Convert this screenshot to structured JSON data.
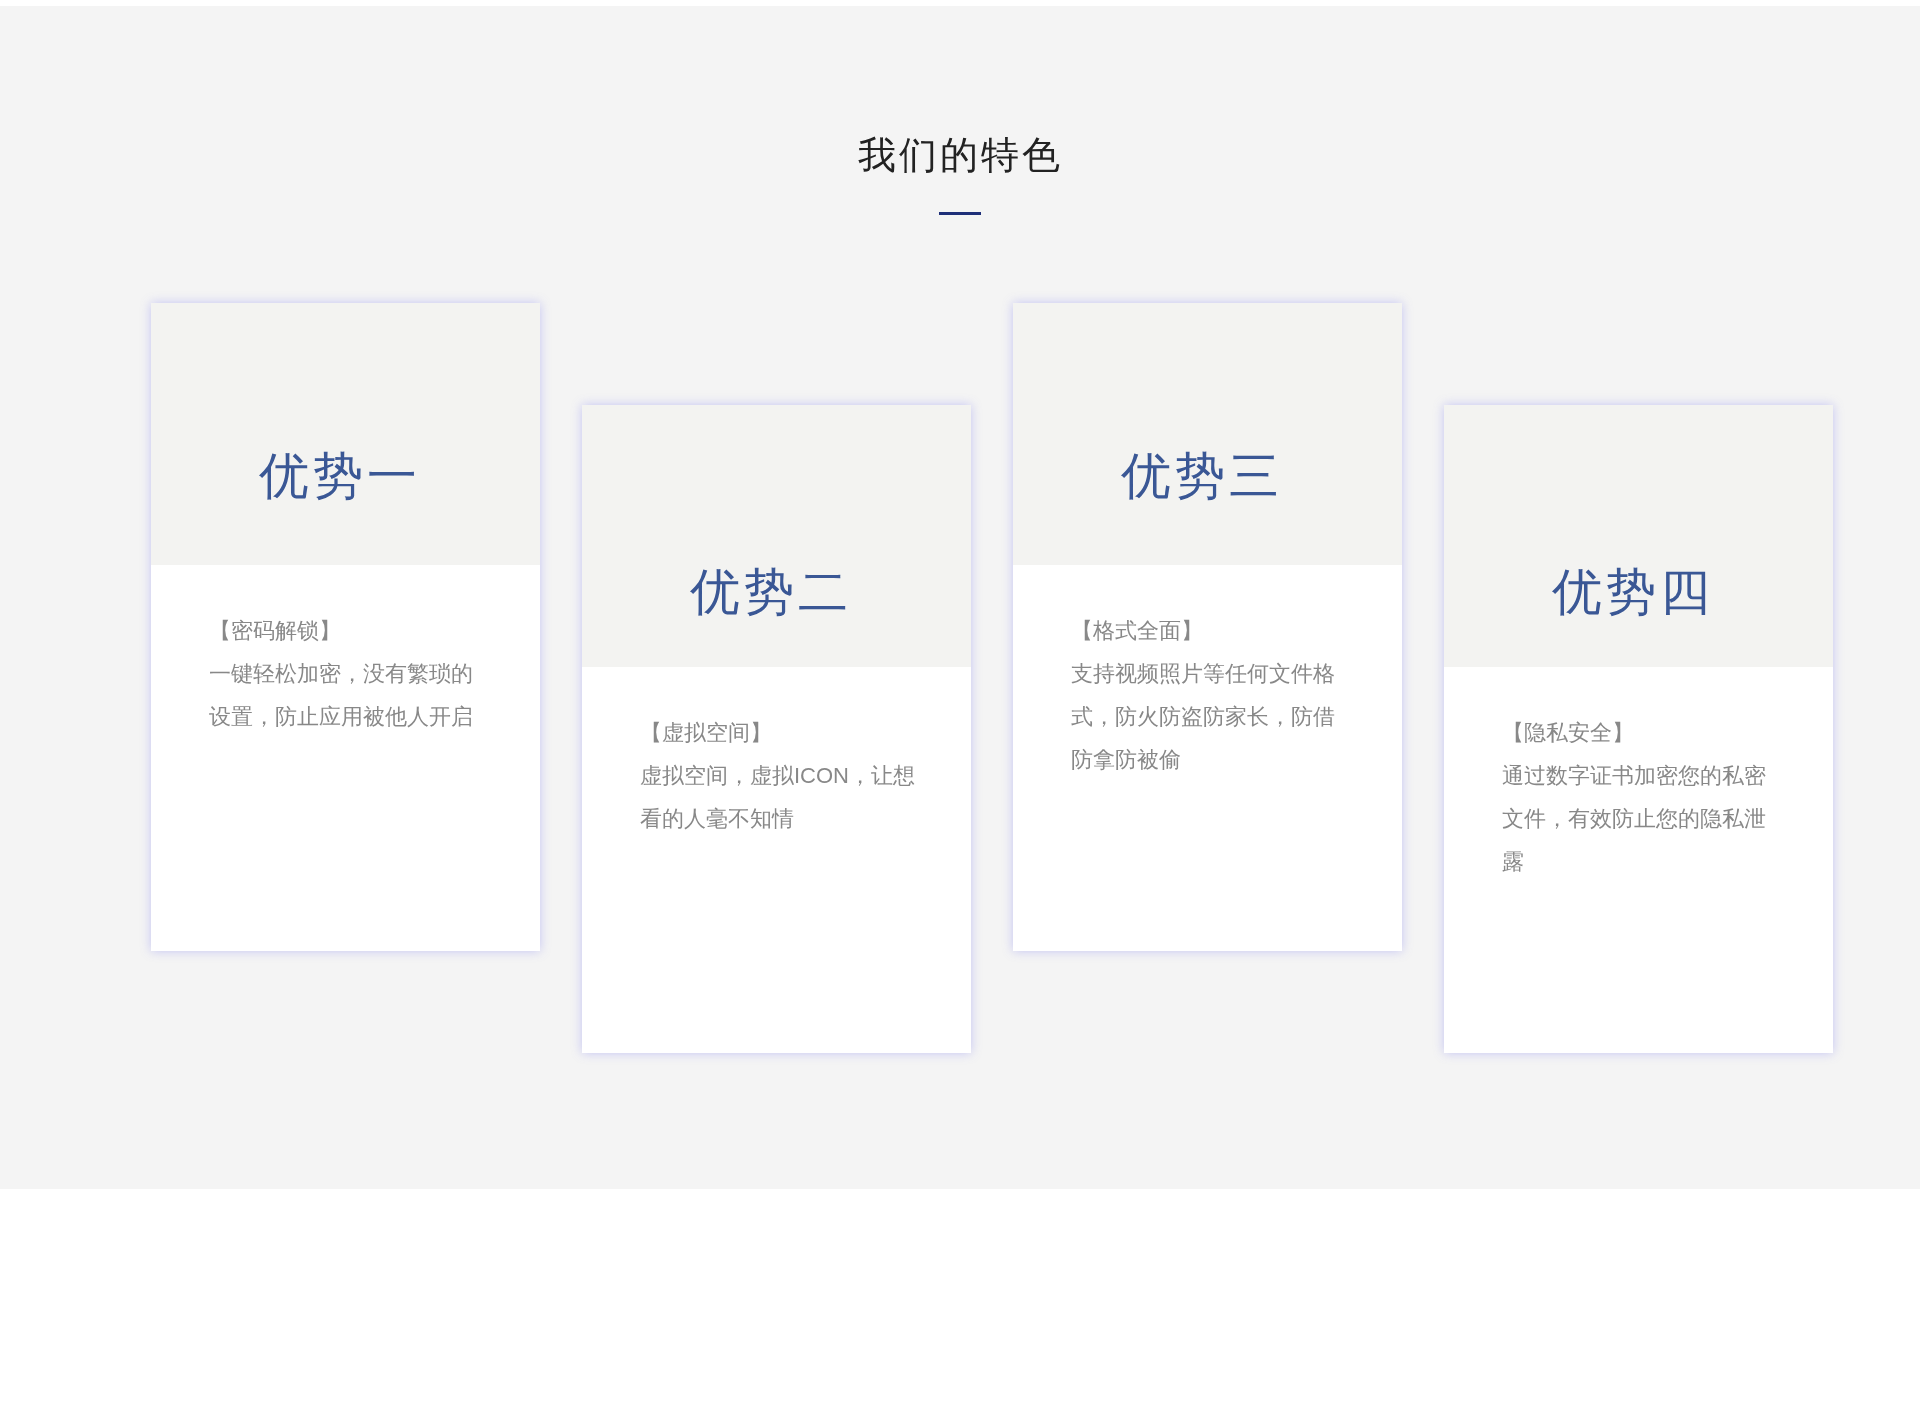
{
  "section": {
    "title": "我们的特色"
  },
  "cards": [
    {
      "heading": "优势一",
      "tag": "【密码解锁】",
      "text": "一键轻松加密，没有繁琐的设置，防止应用被他人开启"
    },
    {
      "heading": "优势二",
      "tag": "【虚拟空间】",
      "text": "虚拟空间，虚拟ICON，让想看的人毫不知情"
    },
    {
      "heading": "优势三",
      "tag": "【格式全面】",
      "text": "支持视频照片等任何文件格式，防火防盗防家长，防借防拿防被偷"
    },
    {
      "heading": "优势四",
      "tag": "【隐私安全】",
      "text": "通过数字证书加密您的私密文件，有效防止您的隐私泄露"
    }
  ]
}
